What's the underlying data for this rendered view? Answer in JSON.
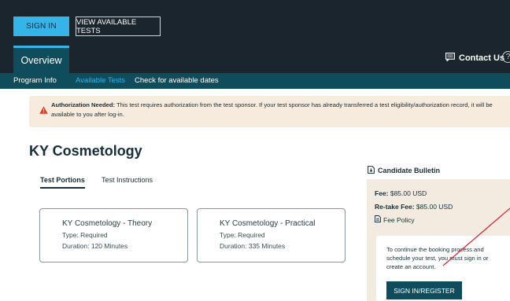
{
  "header": {
    "signin_label": "SIGN IN",
    "view_tests_label": "VIEW AVAILABLE TESTS",
    "overview_tab": "Overview",
    "contact_label": "Contact Us",
    "help_glyph": "?"
  },
  "subnav": {
    "items": [
      "Program Info",
      "Available Tests",
      "Check for available dates"
    ],
    "active_index": 1
  },
  "alert": {
    "title": "Authorization Needed:",
    "body": " This test requires authorization from the test sponsor. If your test sponsor has already transferred a test eligibility/authorization record, it will be available to you after log-in."
  },
  "page": {
    "title": "KY Cosmetology"
  },
  "tabs": {
    "active": "Test Portions",
    "other": "Test Instructions"
  },
  "cards": [
    {
      "title": "KY Cosmetology - Theory",
      "type": "Type: Required",
      "duration": "Duration: 120 Minutes"
    },
    {
      "title": "KY Cosmetology - Practical",
      "type": "Type: Required",
      "duration": "Duration: 335 Minutes"
    }
  ],
  "sidebar": {
    "bulletin_label": "Candidate Bulletin",
    "fee_label": "Fee:",
    "fee_value": " $85.00 USD",
    "retake_label": "Re-take Fee:",
    "retake_value": " $85.00 USD",
    "fee_policy_label": "Fee Policy",
    "signin_message": "To continue the booking process and schedule your test, you must sign in or create an account.",
    "register_label": "SIGN IN/REGISTER"
  },
  "colors": {
    "topbar": "#1b252d",
    "accent": "#35b4e8",
    "teal": "#0f4d5c",
    "alert_bg": "#f6ebdd",
    "alert_icon": "#d9422b",
    "panel_bg": "#f3ebe0",
    "annotation_arrow": "#e0202a"
  },
  "icons": {
    "contact": "chat-icon",
    "help": "question-circle-icon",
    "alert": "warning-triangle-icon",
    "bulletin": "document-download-icon",
    "fee_policy": "document-icon"
  }
}
